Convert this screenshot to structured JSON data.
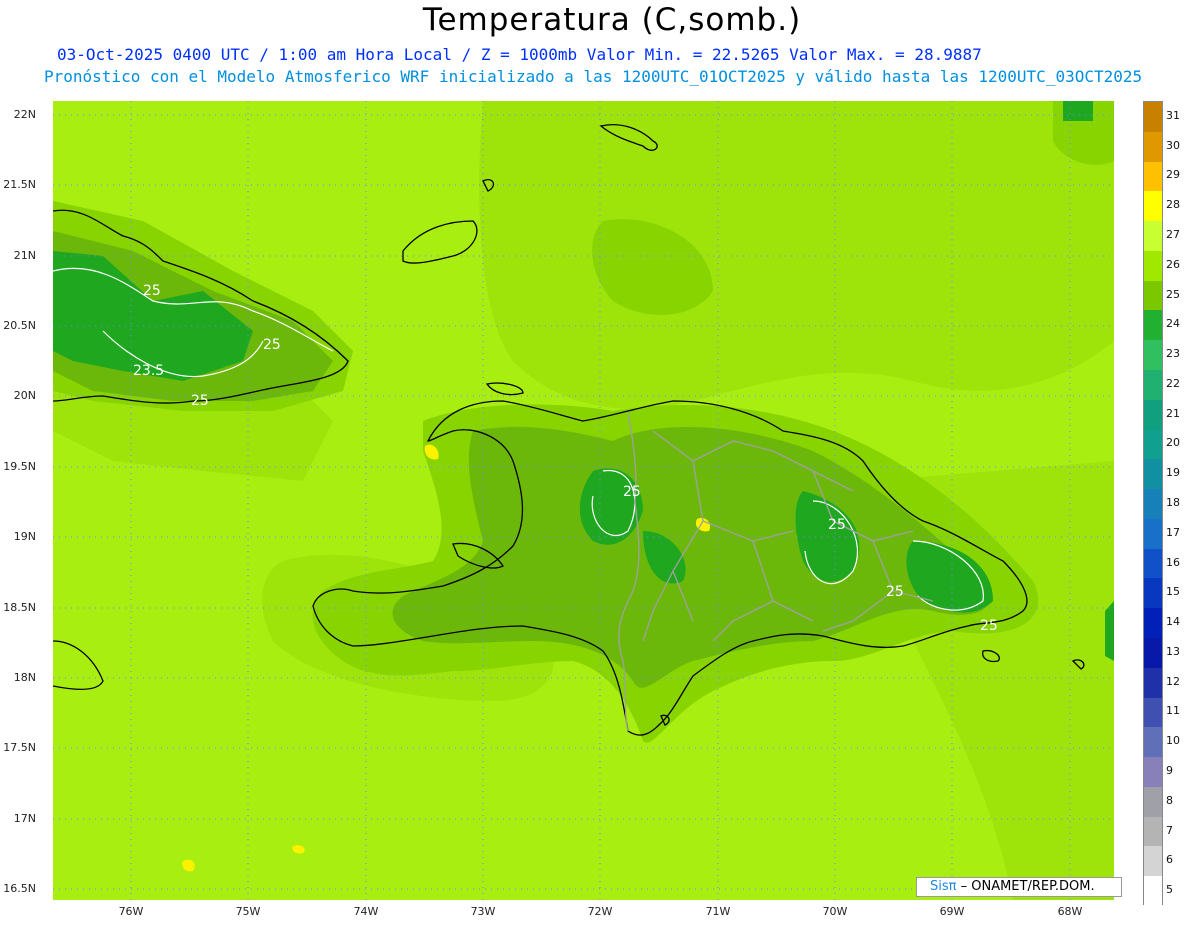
{
  "header": {
    "title": "Temperatura (C,somb.)",
    "line1": "03-Oct-2025  0400 UTC / 1:00 am Hora Local / Z = 1000mb   Valor Min. = 22.5265  Valor Max. = 28.9887",
    "line2": "Pronóstico con el Modelo Atmosferico WRF inicializado a las 1200UTC_01OCT2025 y válido hasta las  1200UTC_03OCT2025"
  },
  "axes": {
    "lat_labels": [
      "22N",
      "21.5N",
      "21N",
      "20.5N",
      "20N",
      "19.5N",
      "19N",
      "18.5N",
      "18N",
      "17.5N",
      "17N",
      "16.5N"
    ],
    "lon_labels": [
      "76W",
      "75W",
      "74W",
      "73W",
      "72W",
      "71W",
      "70W",
      "69W",
      "68W"
    ]
  },
  "map": {
    "contour_labels": [
      "25",
      "25",
      "23.5",
      "25",
      "25",
      "25",
      "25",
      "25"
    ],
    "colors": {
      "base": "#a8ee10",
      "level26": "#88d400",
      "level25": "#6cb80a",
      "level24": "#1fa81f",
      "level23": "#18b24a",
      "level28": "#fff200",
      "coast": "#000000",
      "border": "#a0a0a0",
      "grid": "#7a80ff"
    }
  },
  "colorbar": {
    "labels": [
      "31",
      "30",
      "29",
      "28",
      "27",
      "26",
      "25",
      "24",
      "23",
      "22",
      "21",
      "20",
      "19",
      "18",
      "17",
      "16",
      "15",
      "14",
      "13",
      "12",
      "11",
      "10",
      "9",
      "8",
      "7",
      "6",
      "5"
    ],
    "colors": [
      "#c88000",
      "#e09800",
      "#ffc000",
      "#ffff00",
      "#c8ff30",
      "#a0e800",
      "#7cc800",
      "#22b030",
      "#30c060",
      "#20b070",
      "#10a080",
      "#10a090",
      "#1090a0",
      "#1880b8",
      "#1870c8",
      "#1050c8",
      "#0838c0",
      "#0020b8",
      "#0818a8",
      "#2030a8",
      "#4050b0",
      "#6070b8",
      "#8880b8",
      "#a0a0a8",
      "#b4b4b4",
      "#d4d4d4",
      "#ffffff"
    ]
  },
  "credit": {
    "logo": "Sisπ",
    "text": " – ONAMET/REP.DOM."
  }
}
